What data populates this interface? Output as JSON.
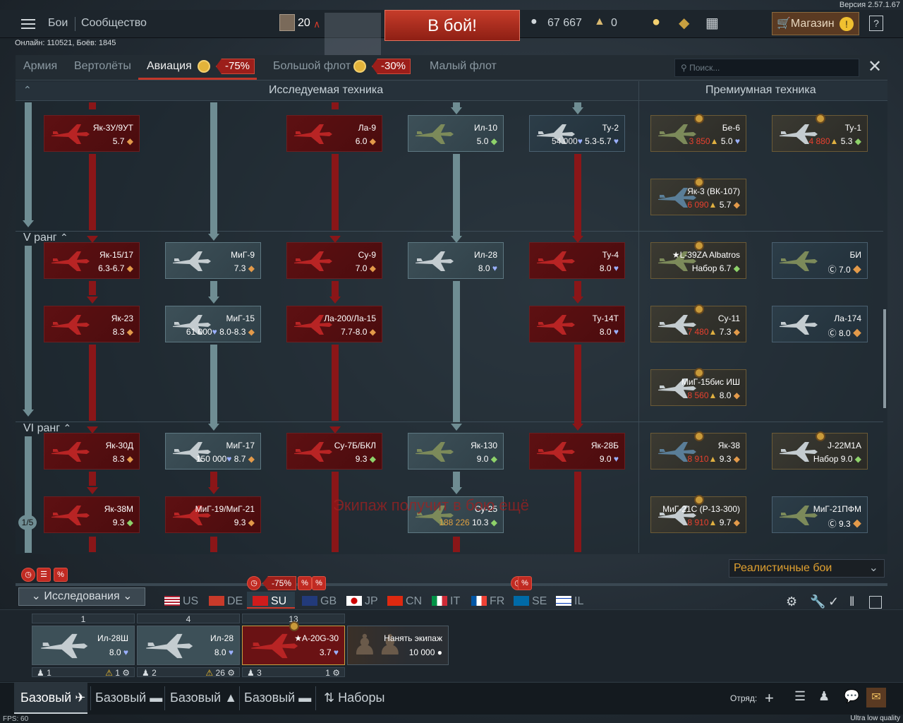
{
  "version": "Версия 2.57.1.67",
  "topnav": {
    "battles": "Бои",
    "community": "Сообщество",
    "level": "20",
    "battle_button": "В бой!",
    "silver": "67 667",
    "gold": "0",
    "shop": "Магазин"
  },
  "online": "Онлайн: 110521, Боёв: 1845",
  "tabs": [
    {
      "label": "Армия"
    },
    {
      "label": "Вертолёты"
    },
    {
      "label": "Авиация",
      "discount": "-75%"
    },
    {
      "label": "Большой флот",
      "discount": "-30%"
    },
    {
      "label": "Малый флот"
    }
  ],
  "search": {
    "placeholder": "Поиск..."
  },
  "tree": {
    "researched_title": "Исследуемая техника",
    "premium_title": "Премиумная техника",
    "rank5": "V ранг",
    "rank6": "VI ранг",
    "page": "1/5",
    "watermark": "Экипаж получит в бою ещё",
    "cards": [
      {
        "id": "yak3u",
        "name": "Як-3У/9УТ",
        "br": "5.7",
        "state": "locked"
      },
      {
        "id": "la9",
        "name": "Ла-9",
        "br": "6.0",
        "state": "locked"
      },
      {
        "id": "il10",
        "name": "Ил-10",
        "br": "5.0",
        "state": "researched"
      },
      {
        "id": "tu2",
        "name": "Ту-2",
        "br": "5.3-5.7",
        "price": "54 000",
        "state": "researched"
      },
      {
        "id": "yak15",
        "name": "Як-15/17",
        "br": "6.3-6.7",
        "state": "locked"
      },
      {
        "id": "mig9",
        "name": "МиГ-9",
        "br": "7.3",
        "state": "researched"
      },
      {
        "id": "su9",
        "name": "Су-9",
        "br": "7.0",
        "state": "locked"
      },
      {
        "id": "il28",
        "name": "Ил-28",
        "br": "8.0",
        "state": "researched"
      },
      {
        "id": "tu4",
        "name": "Ту-4",
        "br": "8.0",
        "state": "locked"
      },
      {
        "id": "yak23",
        "name": "Як-23",
        "br": "8.3",
        "state": "locked"
      },
      {
        "id": "mig15",
        "name": "МиГ-15",
        "br": "8.0-8.3",
        "price": "61 000",
        "state": "researched"
      },
      {
        "id": "la200",
        "name": "Ла-200/Ла-15",
        "br": "7.7-8.0",
        "state": "locked"
      },
      {
        "id": "tu14",
        "name": "Ту-14Т",
        "br": "8.0",
        "state": "locked"
      },
      {
        "id": "yak30",
        "name": "Як-30Д",
        "br": "8.3",
        "state": "locked"
      },
      {
        "id": "mig17",
        "name": "МиГ-17",
        "br": "8.7",
        "price": "150 000",
        "state": "researched"
      },
      {
        "id": "su7",
        "name": "Су-7Б/БКЛ",
        "br": "9.3",
        "state": "locked"
      },
      {
        "id": "yak130",
        "name": "Як-130",
        "br": "9.0",
        "state": "researched"
      },
      {
        "id": "yak28",
        "name": "Як-28Б",
        "br": "9.0",
        "state": "locked"
      },
      {
        "id": "yak38",
        "name": "Як-38М",
        "br": "9.3",
        "state": "locked"
      },
      {
        "id": "mig19",
        "name": "МиГ-19/МиГ-21",
        "br": "9.3",
        "state": "locked"
      },
      {
        "id": "su25",
        "name": "Су-25",
        "br": "10.3",
        "price": "188 226",
        "state": "researched"
      }
    ],
    "premium": [
      {
        "id": "be6",
        "name": "Бе-6",
        "br": "5.0",
        "price": "3 850"
      },
      {
        "id": "tu1",
        "name": "Ту-1",
        "br": "5.3",
        "price": "4 880"
      },
      {
        "id": "yak3vk",
        "name": "Як-3 (ВК-107)",
        "br": "5.7",
        "price": "6 090"
      },
      {
        "id": "l39",
        "name": "★L-39ZA Albatros",
        "br": "Набор 6.7"
      },
      {
        "id": "bi",
        "name": "БИ",
        "br": "7.0"
      },
      {
        "id": "su11",
        "name": "Су-11",
        "br": "7.3",
        "price": "7 480"
      },
      {
        "id": "la174",
        "name": "Ла-174",
        "br": "8.0"
      },
      {
        "id": "mig15ish",
        "name": "МиГ-15бис ИШ",
        "br": "8.0",
        "price": "8 560"
      },
      {
        "id": "yak38p",
        "name": "Як-38",
        "br": "9.3",
        "price": "8 910"
      },
      {
        "id": "j22",
        "name": "J-22M1A",
        "br": "Набор 9.0"
      },
      {
        "id": "mig21s",
        "name": "МиГ-21С (Р-13-300)",
        "br": "9.7",
        "price": "8 910"
      },
      {
        "id": "mig21pfm",
        "name": "МиГ-21ПФМ",
        "br": "9.3"
      }
    ]
  },
  "mode": "Реалистичные бои",
  "research_label": "Исследования",
  "nations": [
    {
      "code": "US"
    },
    {
      "code": "DE"
    },
    {
      "code": "SU",
      "discount": "-75%"
    },
    {
      "code": "GB"
    },
    {
      "code": "JP"
    },
    {
      "code": "CN"
    },
    {
      "code": "IT"
    },
    {
      "code": "FR"
    },
    {
      "code": "SE"
    },
    {
      "code": "IL"
    }
  ],
  "slots": [
    {
      "count": "1",
      "name": "Ил-28Ш",
      "br": "8.0",
      "crew": "1",
      "val": "1"
    },
    {
      "count": "4",
      "name": "Ил-28",
      "br": "8.0",
      "crew": "2",
      "val": "26"
    },
    {
      "count": "13",
      "name": "★A-20G-30",
      "br": "3.7",
      "crew": "3",
      "val": "1"
    }
  ],
  "hire": {
    "label": "Нанять экипаж",
    "price": "10 000"
  },
  "presets": [
    {
      "label": "Базовый"
    },
    {
      "label": "Базовый"
    },
    {
      "label": "Базовый"
    },
    {
      "label": "Базовый"
    },
    {
      "label": "Наборы"
    }
  ],
  "squad": "Отряд:",
  "fps": "FPS: 60",
  "quality": "Ultra low quality",
  "colors": {
    "accent": "#c2372a",
    "locked": "#5e1012",
    "researched": "#3d5058",
    "gold": "#e0a030"
  }
}
